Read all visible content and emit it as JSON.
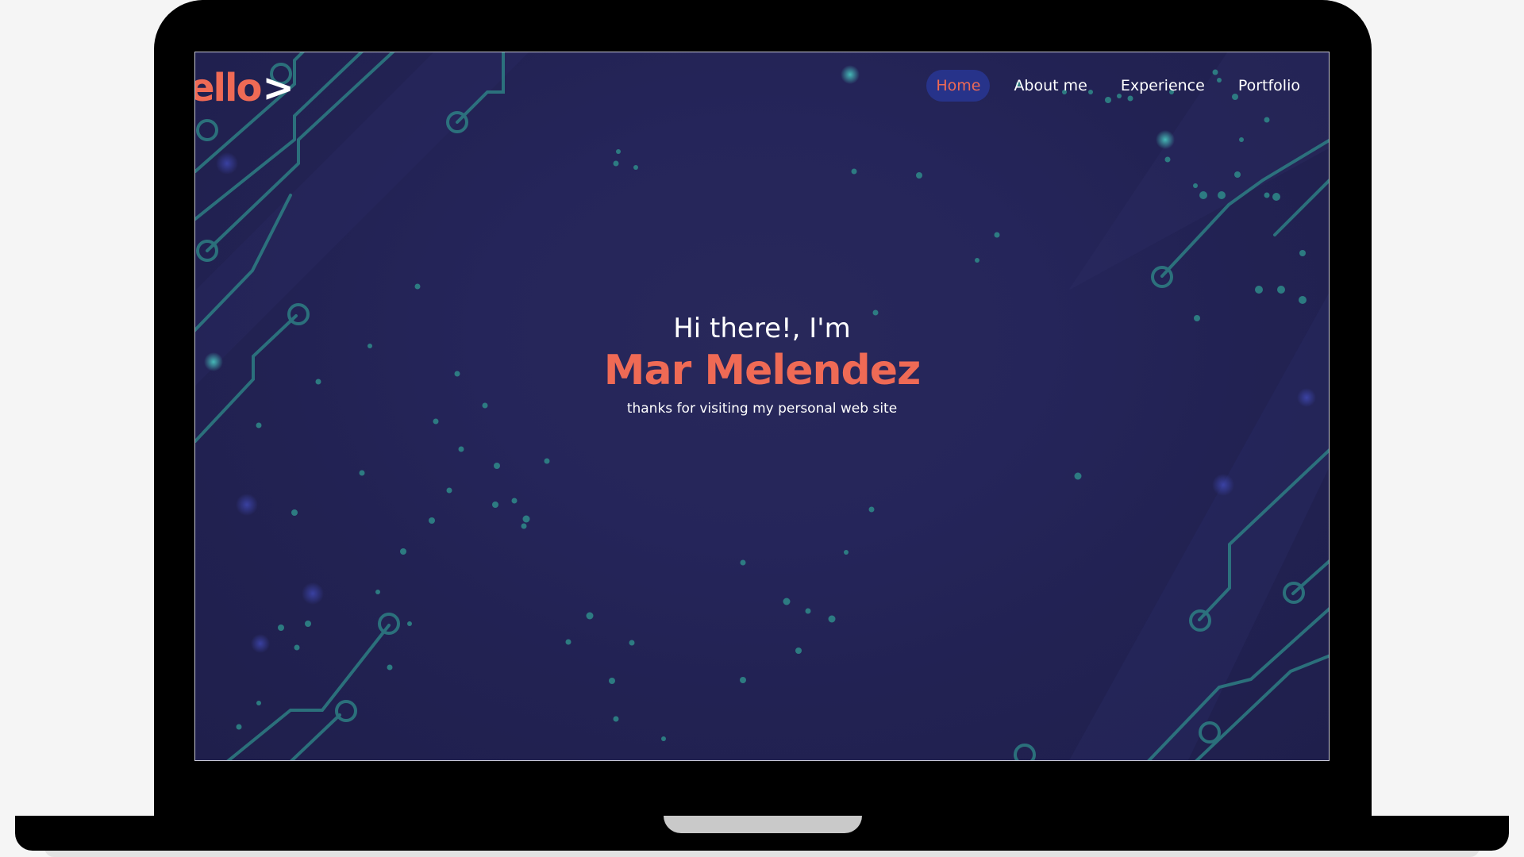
{
  "site": {
    "logo_text": "ello",
    "logo_arrow": ">"
  },
  "nav": {
    "items": [
      {
        "label": "Home",
        "active": true
      },
      {
        "label": "About me",
        "active": false
      },
      {
        "label": "Experience",
        "active": false
      },
      {
        "label": "Portfolio",
        "active": false
      }
    ]
  },
  "hero": {
    "greeting": "Hi there!, I'm",
    "name": "Mar Melendez",
    "tagline": "thanks for visiting my personal web site"
  },
  "colors": {
    "accent": "#ef6a55",
    "background": "#25255a",
    "active_nav_bg": "#27338a",
    "circuit": "#2e7d82"
  },
  "icons": [
    "chevron-right-icon",
    "circuit-background-art"
  ]
}
